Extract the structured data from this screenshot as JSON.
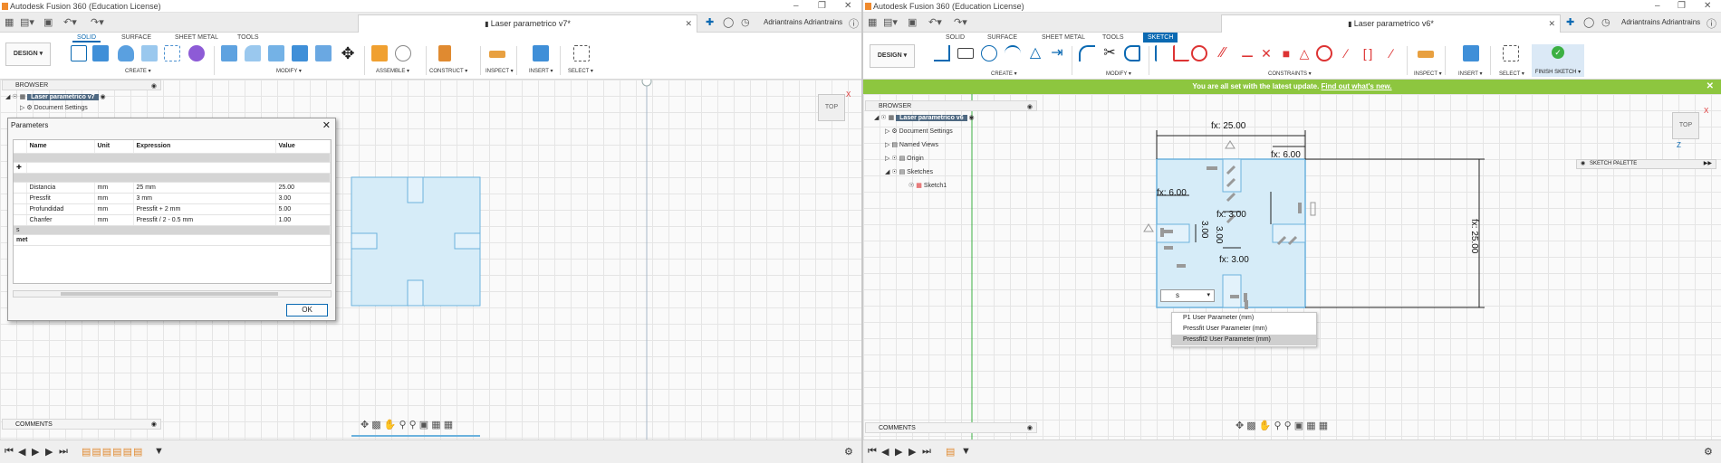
{
  "left": {
    "title": "Autodesk Fusion 360 (Education License)",
    "tab": "Laser parametrico v7*",
    "user": "Adriantrains Adriantrains",
    "design_label": "DESIGN",
    "tabs": [
      "SOLID",
      "SURFACE",
      "SHEET METAL",
      "TOOLS"
    ],
    "groups": [
      "CREATE",
      "MODIFY",
      "ASSEMBLE",
      "CONSTRUCT",
      "INSPECT",
      "INSERT",
      "SELECT"
    ],
    "browser": {
      "header": "BROWSER",
      "root": "Laser parametrico v7",
      "first_child": "Document Settings"
    },
    "view_label": "TOP",
    "comments": "COMMENTS",
    "dialog": {
      "title": "Parameters",
      "headers": [
        "Name",
        "Unit",
        "Expression",
        "Value"
      ],
      "rows": [
        {
          "name": "Distancia",
          "unit": "mm",
          "expression": "25 mm",
          "value": "25.00"
        },
        {
          "name": "Pressfit",
          "unit": "mm",
          "expression": "3 mm",
          "value": "3.00"
        },
        {
          "name": "Profundidad",
          "unit": "mm",
          "expression": "Pressfit + 2 mm",
          "value": "5.00"
        },
        {
          "name": "Chanfer",
          "unit": "mm",
          "expression": "Pressfit / 2 - 0.5 mm",
          "value": "1.00"
        }
      ],
      "row_a": "s",
      "row_b": "met",
      "ok": "OK"
    }
  },
  "right": {
    "title": "Autodesk Fusion 360 (Education License)",
    "tab": "Laser parametrico v6*",
    "user": "Adriantrains Adriantrains",
    "design_label": "DESIGN",
    "tabs": [
      "SOLID",
      "SURFACE",
      "SHEET METAL",
      "TOOLS",
      "SKETCH"
    ],
    "groups": [
      "CREATE",
      "MODIFY",
      "CONSTRAINTS",
      "INSPECT",
      "INSERT",
      "SELECT"
    ],
    "finish": "FINISH SKETCH",
    "banner": {
      "text": "You are all set with the latest update.",
      "link": "Find out what's new."
    },
    "browser": {
      "header": "BROWSER",
      "root": "Laser parametrico v6",
      "items": [
        "Document Settings",
        "Named Views",
        "Origin",
        "Sketches",
        "Sketch1"
      ]
    },
    "view_label": "TOP",
    "palette": "SKETCH PALETTE",
    "comments": "COMMENTS",
    "dims": {
      "top": "fx: 25.00",
      "right": "fx: 25.00",
      "top_slot": "fx: 6.00",
      "left_slot": "fx: 6.00",
      "center_a": "fx: 3.00",
      "center_b": "fx: 3.00",
      "vert_a": "3.00",
      "vert_b": "3.00"
    },
    "input_value": "s",
    "autocomplete": [
      {
        "name": "P1",
        "type": "User Parameter (mm)"
      },
      {
        "name": "Pressfit",
        "type": "User Parameter (mm)"
      },
      {
        "name": "Pressfit2",
        "type": "User Parameter (mm)"
      }
    ]
  },
  "colors": {
    "accent": "#0a69b2",
    "banner": "#8dc63f",
    "sketch_fill": "#d6ecf8",
    "sketch_line": "#6cb2dd"
  }
}
